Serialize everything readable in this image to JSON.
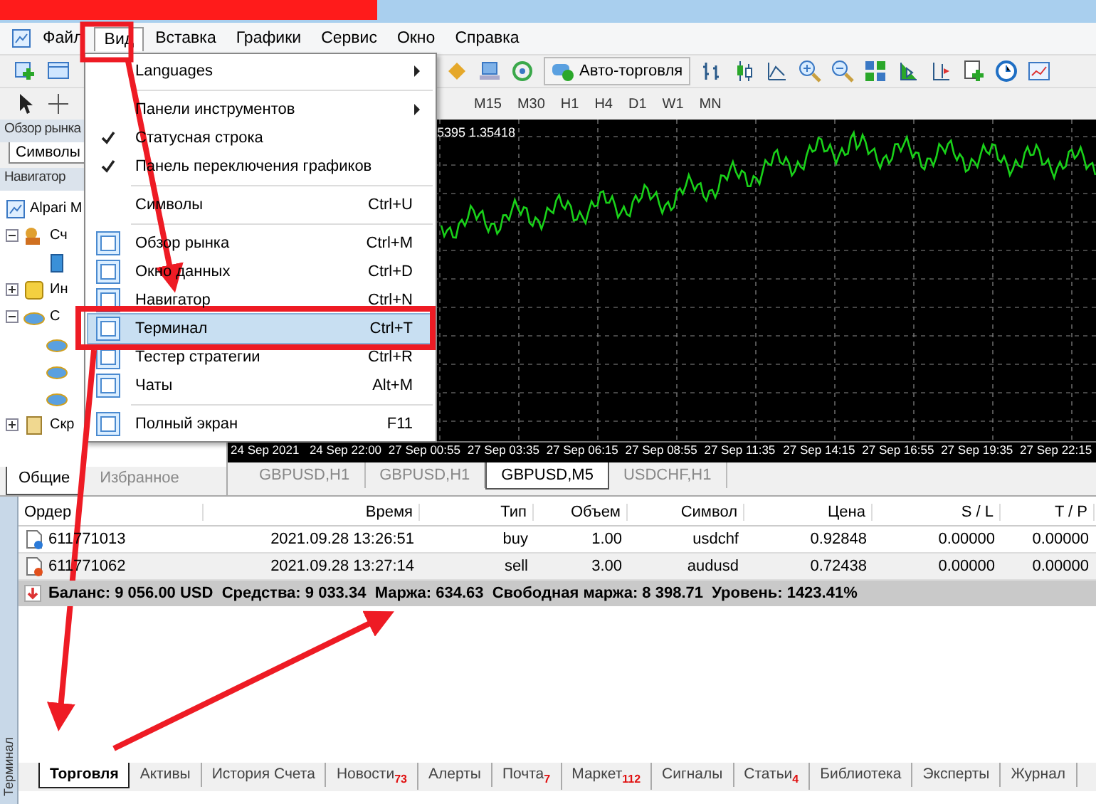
{
  "menu_bar": [
    {
      "label": "Файл",
      "selected": false
    },
    {
      "label": "Вид",
      "selected": true
    },
    {
      "label": "Вставка",
      "selected": false
    },
    {
      "label": "Графики",
      "selected": false
    },
    {
      "label": "Сервис",
      "selected": false
    },
    {
      "label": "Окно",
      "selected": false
    },
    {
      "label": "Справка",
      "selected": false
    }
  ],
  "toolbar": {
    "auto_trading": "Авто-торговля"
  },
  "timeframes": [
    "M15",
    "M30",
    "H1",
    "H4",
    "D1",
    "W1",
    "MN"
  ],
  "market_watch": {
    "title": "Обзор рынка",
    "tab": "Символы"
  },
  "navigator": {
    "title": "Навигатор",
    "tree": [
      {
        "label": "Alpari M",
        "children": [
          {
            "label": "Сч",
            "kind": "accounts",
            "expanded": true,
            "children": [
              {
                "kind": "account"
              }
            ]
          },
          {
            "label": "Ин",
            "kind": "indicators",
            "expanded": false
          },
          {
            "label": "С",
            "kind": "experts",
            "expanded": true,
            "children": [
              {
                "kind": "expert"
              },
              {
                "kind": "expert"
              },
              {
                "kind": "expert"
              }
            ]
          },
          {
            "label": "Скр",
            "kind": "scripts",
            "expanded": false
          }
        ]
      }
    ],
    "tabs": [
      {
        "label": "Общие",
        "selected": true
      },
      {
        "label": "Избранное",
        "selected": false
      }
    ]
  },
  "chart": {
    "quote": "5395 1.35418",
    "time_labels": [
      "24 Sep 2021",
      "24 Sep 22:00",
      "27 Sep 00:55",
      "27 Sep 03:35",
      "27 Sep 06:15",
      "27 Sep 08:55",
      "27 Sep 11:35",
      "27 Sep 14:15",
      "27 Sep 16:55",
      "27 Sep 19:35",
      "27 Sep 22:15"
    ],
    "tabs": [
      {
        "label": "GBPUSD,H1",
        "selected": false
      },
      {
        "label": "GBPUSD,H1",
        "selected": false
      },
      {
        "label": "GBPUSD,M5",
        "selected": true
      },
      {
        "label": "USDCHF,H1",
        "selected": false
      }
    ]
  },
  "view_menu": [
    {
      "kind": "plain",
      "label": "Languages",
      "submenu": true,
      "checked": false,
      "selected": false
    },
    {
      "kind": "separator"
    },
    {
      "kind": "plain",
      "label": "Панели инструментов",
      "submenu": true,
      "checked": false,
      "selected": false
    },
    {
      "kind": "plain",
      "label": "Статусная строка",
      "submenu": false,
      "checked": true,
      "selected": false
    },
    {
      "kind": "plain",
      "label": "Панель переключения графиков",
      "submenu": false,
      "checked": true,
      "selected": false
    },
    {
      "kind": "separator"
    },
    {
      "kind": "plain",
      "label": "Символы",
      "shortcut": "Ctrl+U",
      "submenu": false,
      "checked": false,
      "selected": false
    },
    {
      "kind": "separator"
    },
    {
      "kind": "icon",
      "label": "Обзор рынка",
      "shortcut": "Ctrl+M",
      "submenu": false,
      "checked": false,
      "selected": false
    },
    {
      "kind": "icon",
      "label": "Окно данных",
      "shortcut": "Ctrl+D",
      "submenu": false,
      "checked": false,
      "selected": false
    },
    {
      "kind": "icon",
      "label": "Навигатор",
      "shortcut": "Ctrl+N",
      "submenu": false,
      "checked": false,
      "selected": false
    },
    {
      "kind": "icon",
      "label": "Терминал",
      "shortcut": "Ctrl+T",
      "submenu": false,
      "checked": false,
      "selected": true
    },
    {
      "kind": "icon",
      "label": "Тестер стратегии",
      "shortcut": "Ctrl+R",
      "submenu": false,
      "checked": false,
      "selected": false
    },
    {
      "kind": "icon",
      "label": "Чаты",
      "shortcut": "Alt+M",
      "submenu": false,
      "checked": false,
      "selected": false
    },
    {
      "kind": "separator"
    },
    {
      "kind": "icon",
      "label": "Полный экран",
      "shortcut": "F11",
      "submenu": false,
      "checked": false,
      "selected": false
    }
  ],
  "terminal": {
    "title": "Терминал",
    "columns": [
      "Ордер",
      "Время",
      "Тип",
      "Объем",
      "Символ",
      "Цена",
      "S / L",
      "T / P"
    ],
    "rows": [
      {
        "kind": "buy",
        "cells": [
          "611771013",
          "2021.09.28 13:26:51",
          "buy",
          "1.00",
          "usdchf",
          "0.92848",
          "0.00000",
          "0.00000"
        ]
      },
      {
        "kind": "sell",
        "cells": [
          "611771062",
          "2021.09.28 13:27:14",
          "sell",
          "3.00",
          "audusd",
          "0.72438",
          "0.00000",
          "0.00000"
        ]
      }
    ],
    "summary": "Баланс: 9 056.00 USD  Средства: 9 033.34  Маржа: 634.63  Свободная маржа: 8 398.71  Уровень: 1423.41%",
    "tabs": [
      {
        "label": "Торговля",
        "selected": true
      },
      {
        "label": "Активы",
        "selected": false
      },
      {
        "label": "История Счета",
        "selected": false
      },
      {
        "label": "Новости",
        "badge": "73",
        "selected": false
      },
      {
        "label": "Алерты",
        "selected": false
      },
      {
        "label": "Почта",
        "badge": "7",
        "selected": false
      },
      {
        "label": "Маркет",
        "badge": "112",
        "selected": false
      },
      {
        "label": "Сигналы",
        "selected": false
      },
      {
        "label": "Статьи",
        "badge": "4",
        "selected": false
      },
      {
        "label": "Библиотека",
        "selected": false
      },
      {
        "label": "Эксперты",
        "selected": false
      },
      {
        "label": "Журнал",
        "selected": false
      }
    ]
  }
}
